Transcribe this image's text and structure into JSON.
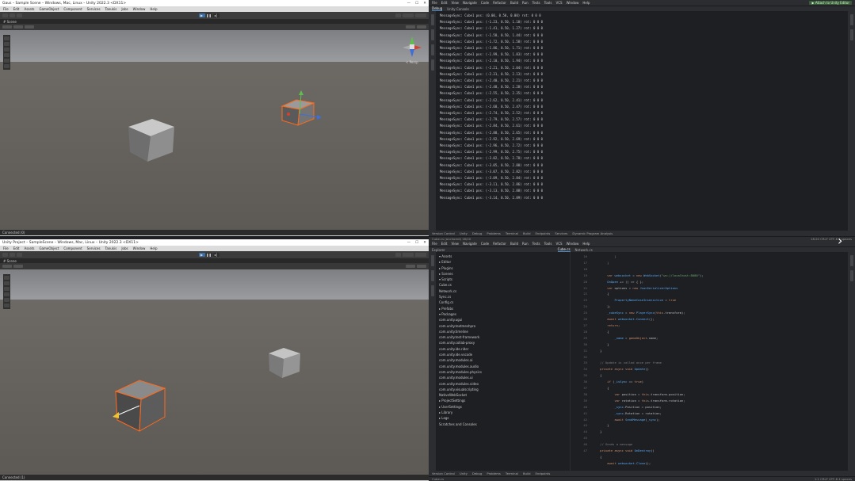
{
  "top_left": {
    "title": "Gaus – Sample Scene – Windows, Mac, Linux – Unity 2022.3 <DX11>",
    "menu": [
      "File",
      "Edit",
      "Assets",
      "GameObject",
      "Component",
      "Services",
      "Tanukis",
      "Jobs",
      "Window",
      "Help"
    ],
    "scene_tab": "# Scene",
    "status": "Connected (0)",
    "persp_label": "< Persp"
  },
  "bottom_left": {
    "title": "Unity Project – SampleScene – Windows, Mac, Linux – Unity 2022.3 <DX11>",
    "menu": [
      "File",
      "Edit",
      "Assets",
      "GameObject",
      "Component",
      "Services",
      "Tanukis",
      "Jobs",
      "Window",
      "Help"
    ],
    "scene_tab": "# Scene",
    "status": "Connected (1)"
  },
  "top_right": {
    "menu": [
      "File",
      "Edit",
      "View",
      "Navigate",
      "Code",
      "Refactor",
      "Build",
      "Run",
      "Tests",
      "Tools",
      "VCS",
      "Window",
      "Help"
    ],
    "run_label": "▶ Attach to Unity Editor",
    "tabs": [
      "Debug",
      "Unity Console"
    ],
    "console_lines": [
      "MessageSync: Cube1 pos: (0.00, 0.50, 0.00) rot: 0 0 0",
      "MessageSync: Cube1 pos: (-1.23, 0.50, 1.10) rot: 0 0 0",
      "MessageSync: Cube1 pos: (-1.41, 0.50, 1.27) rot: 0 0 0",
      "MessageSync: Cube1 pos: (-1.58, 0.50, 1.44) rot: 0 0 0",
      "MessageSync: Cube1 pos: (-1.72, 0.50, 1.58) rot: 0 0 0",
      "MessageSync: Cube1 pos: (-1.86, 0.50, 1.71) rot: 0 0 0",
      "MessageSync: Cube1 pos: (-1.99, 0.50, 1.83) rot: 0 0 0",
      "MessageSync: Cube1 pos: (-2.10, 0.50, 1.94) rot: 0 0 0",
      "MessageSync: Cube1 pos: (-2.21, 0.50, 2.04) rot: 0 0 0",
      "MessageSync: Cube1 pos: (-2.31, 0.50, 2.13) rot: 0 0 0",
      "MessageSync: Cube1 pos: (-2.40, 0.50, 2.21) rot: 0 0 0",
      "MessageSync: Cube1 pos: (-2.48, 0.50, 2.28) rot: 0 0 0",
      "MessageSync: Cube1 pos: (-2.55, 0.50, 2.35) rot: 0 0 0",
      "MessageSync: Cube1 pos: (-2.62, 0.50, 2.41) rot: 0 0 0",
      "MessageSync: Cube1 pos: (-2.68, 0.50, 2.47) rot: 0 0 0",
      "MessageSync: Cube1 pos: (-2.74, 0.50, 2.52) rot: 0 0 0",
      "MessageSync: Cube1 pos: (-2.79, 0.50, 2.57) rot: 0 0 0",
      "MessageSync: Cube1 pos: (-2.84, 0.50, 2.61) rot: 0 0 0",
      "MessageSync: Cube1 pos: (-2.88, 0.50, 2.65) rot: 0 0 0",
      "MessageSync: Cube1 pos: (-2.92, 0.50, 2.69) rot: 0 0 0",
      "MessageSync: Cube1 pos: (-2.96, 0.50, 2.72) rot: 0 0 0",
      "MessageSync: Cube1 pos: (-2.99, 0.50, 2.75) rot: 0 0 0",
      "MessageSync: Cube1 pos: (-3.02, 0.50, 2.78) rot: 0 0 0",
      "MessageSync: Cube1 pos: (-3.05, 0.50, 2.80) rot: 0 0 0",
      "MessageSync: Cube1 pos: (-3.07, 0.50, 2.82) rot: 0 0 0",
      "MessageSync: Cube1 pos: (-3.09, 0.50, 2.84) rot: 0 0 0",
      "MessageSync: Cube1 pos: (-3.11, 0.50, 2.86) rot: 0 0 0",
      "MessageSync: Cube1 pos: (-3.13, 0.50, 2.88) rot: 0 0 0",
      "MessageSync: Cube1 pos: (-3.14, 0.50, 2.89) rot: 0 0 0"
    ],
    "bottom_tabs": [
      "Version Control",
      "Unity",
      "Debug",
      "Problems",
      "Terminal",
      "Build",
      "Endpoints",
      "Services",
      "Dynamic Program Analysis"
    ],
    "status_left": "Cube.cs (anchored) 18/20",
    "status_right": "18:20   CRLF   UTF-8   4 spaces"
  },
  "bottom_right": {
    "menu": [
      "File",
      "Edit",
      "View",
      "Navigate",
      "Code",
      "Refactor",
      "Build",
      "Run",
      "Tests",
      "Tools",
      "VCS",
      "Window",
      "Help"
    ],
    "tabs": [
      "Explorer",
      "Cube.cs",
      "Network.cs"
    ],
    "explorer_rows": [
      "▾ Assets",
      "  ▸ Editor",
      "  ▸ Plugins",
      "  ▸ Scenes",
      "  ▾ Scripts",
      "      Cube.cs",
      "      Network.cs",
      "      Sync.cs",
      "      Config.cs",
      "  ▸ Prefabs",
      "  ▾ Packages",
      "      com.unity.ugui",
      "      com.unity.textmeshpro",
      "      com.unity.timeline",
      "      com.unity.test-framework",
      "      com.unity.collab-proxy",
      "      com.unity.ide.rider",
      "      com.unity.ide.vscode",
      "      com.unity.modules.ai",
      "      com.unity.modules.audio",
      "      com.unity.modules.physics",
      "      com.unity.modules.ui",
      "      com.unity.modules.video",
      "      com.unity.visualscripting",
      "      NativeWebSocket",
      "  ▸ ProjectSettings",
      "  ▸ UserSettings",
      "  ▸ Library",
      "  ▸ Logs",
      "  Scratches and Consoles"
    ],
    "line_numbers": [
      "16",
      "17",
      "18",
      "19",
      "20",
      "21",
      "22",
      "23",
      "24",
      "25",
      "26",
      "27",
      "28",
      "29",
      "30",
      "31",
      "32",
      "33",
      "34",
      "35",
      "36",
      "37",
      "38",
      "39",
      "40",
      "41",
      "42",
      "43",
      "44",
      "45",
      "46",
      "47"
    ],
    "bottom_tabs": [
      "Version Control",
      "Unity",
      "Debug",
      "Problems",
      "Terminal",
      "Build",
      "Endpoints"
    ],
    "status_left": "Cube.cs",
    "status_right": "1:1   CRLF   UTF-8   4 spaces"
  }
}
